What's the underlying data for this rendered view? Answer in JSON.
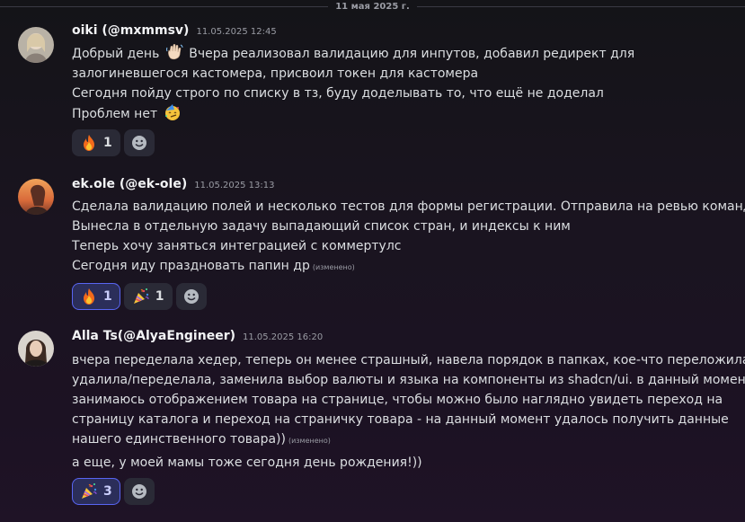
{
  "date_divider": "11 мая 2025 г.",
  "messages": [
    {
      "username": "oiki (@mxmmsv)",
      "timestamp": "11.05.2025 12:45",
      "avatar_icon": "user-avatar-light-hair",
      "line1_a": "Добрый день",
      "line1_b": "Вчера реализовал валидацию для инпутов, добавил редирект для",
      "line2": "залогиневшегося кастомера, присвоил токен для кастомера",
      "line3": "Сегодня пойду строго по списку в тз, буду доделывать то, что ещё не доделал",
      "line4": "Проблем нет",
      "reactions": [
        {
          "emoji": "fire-emoji",
          "count": "1",
          "active": false
        }
      ]
    },
    {
      "username": "ek.ole (@ek-ole)",
      "timestamp": "11.05.2025 13:13",
      "avatar_icon": "user-avatar-sunset",
      "line1": "Сделала валидацию полей и несколько тестов для формы регистрации. Отправила на ревью команде",
      "line2": "Вынесла в отдельную задачу выпадающий список стран, и индексы к ним",
      "line3": "Теперь хочу заняться интеграцией с коммертулс",
      "line4": "Сегодня иду праздновать папин др",
      "edited": "(изменено)",
      "reactions": [
        {
          "emoji": "fire-emoji",
          "count": "1",
          "active": true
        },
        {
          "emoji": "party-popper-emoji",
          "count": "1",
          "active": false
        }
      ]
    },
    {
      "username": "Alla Ts(@AlyaEngineer)",
      "timestamp": "11.05.2025 16:20",
      "avatar_icon": "user-avatar-dark-hair",
      "line1": "вчера переделала хедер, теперь он менее страшный, навела порядок в папках, кое-что переложила/",
      "line2": "удалила/переделала, заменила выбор валюты и языка на компоненты из shadcn/ui. в данный момент",
      "line3": "занимаюсь отображением товара на странице, чтобы можно было наглядно увидеть переход на",
      "line4": "страницу каталога и переход на страничку товара  - на данный момент удалось получить данные",
      "line5": "нашего единственного товара))",
      "edited": "(изменено)",
      "line6": "а еще, у моей мамы тоже сегодня день рождения!))",
      "reactions": [
        {
          "emoji": "party-popper-emoji",
          "count": "3",
          "active": true
        }
      ]
    }
  ],
  "colors": {
    "accent": "#5865f2",
    "active_reaction_bg": "#2b2e5a",
    "reaction_bg": "#2a2a36"
  }
}
